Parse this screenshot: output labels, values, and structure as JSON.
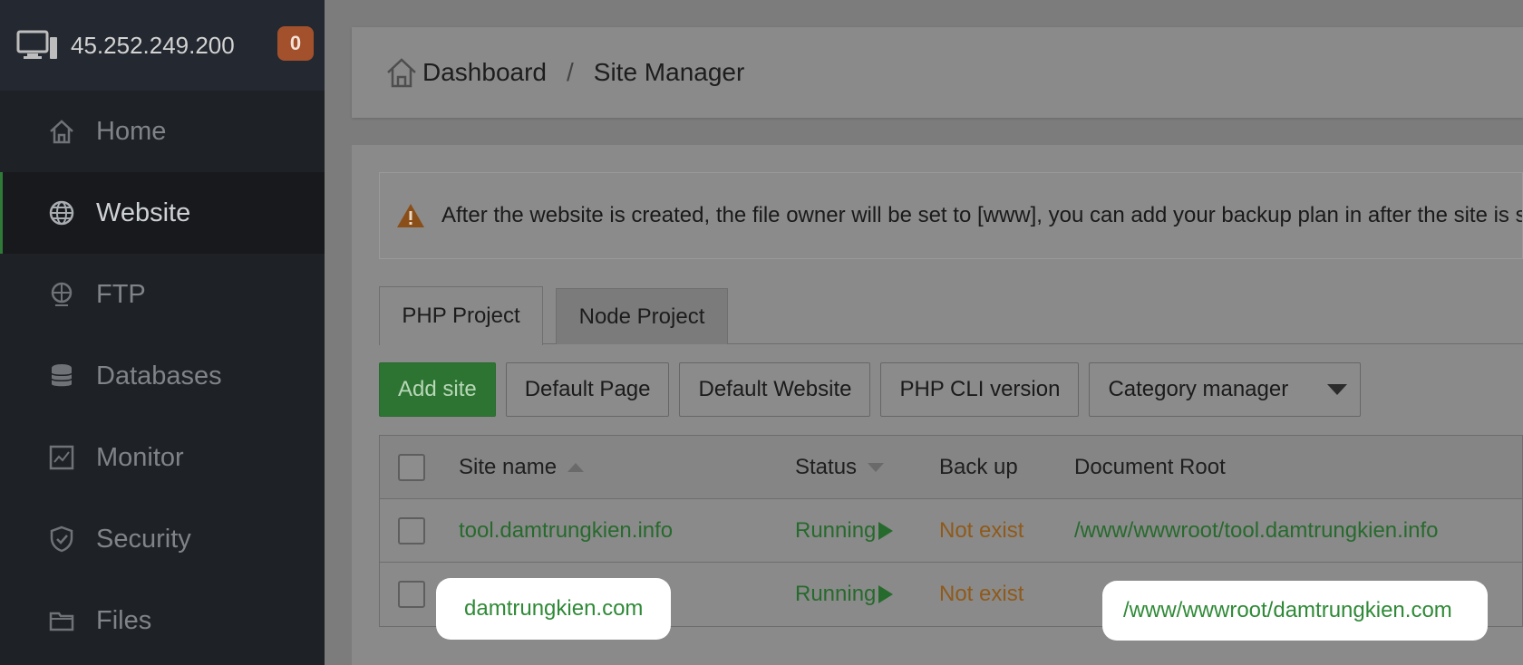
{
  "server": {
    "ip": "45.252.249.200",
    "notifications": "0"
  },
  "sidebar": {
    "items": [
      {
        "label": "Home",
        "icon": "home-icon"
      },
      {
        "label": "Website",
        "icon": "globe-icon",
        "active": true
      },
      {
        "label": "FTP",
        "icon": "ftp-icon"
      },
      {
        "label": "Databases",
        "icon": "database-icon"
      },
      {
        "label": "Monitor",
        "icon": "monitor-icon"
      },
      {
        "label": "Security",
        "icon": "shield-icon"
      },
      {
        "label": "Files",
        "icon": "folder-icon"
      }
    ]
  },
  "breadcrumb": {
    "home": "Dashboard",
    "separator": "/",
    "current": "Site Manager"
  },
  "alert": {
    "text": "After the website is created, the file owner will be set to [www], you can add your backup plan in after the site is s"
  },
  "tabs": [
    {
      "label": "PHP Project"
    },
    {
      "label": "Node Project"
    }
  ],
  "toolbar": {
    "add_site": "Add site",
    "default_page": "Default Page",
    "default_website": "Default Website",
    "php_cli": "PHP CLI version",
    "category": "Category manager"
  },
  "table": {
    "headers": {
      "site_name": "Site name",
      "status": "Status",
      "backup": "Back up",
      "root": "Document Root"
    },
    "rows": [
      {
        "site": "tool.damtrungkien.info",
        "status": "Running",
        "backup": "Not exist",
        "root": "/www/wwwroot/tool.damtrungkien.info"
      },
      {
        "site": "damtrungkien.com",
        "status": "Running",
        "backup": "Not exist",
        "root": "/www/wwwroot/damtrungkien.com"
      }
    ]
  },
  "colors": {
    "accent": "#2d7432",
    "running": "#276a2d",
    "backup_missing": "#8f5a1b",
    "highlight_text": "#2f8a37",
    "badge": "#a3512c"
  }
}
